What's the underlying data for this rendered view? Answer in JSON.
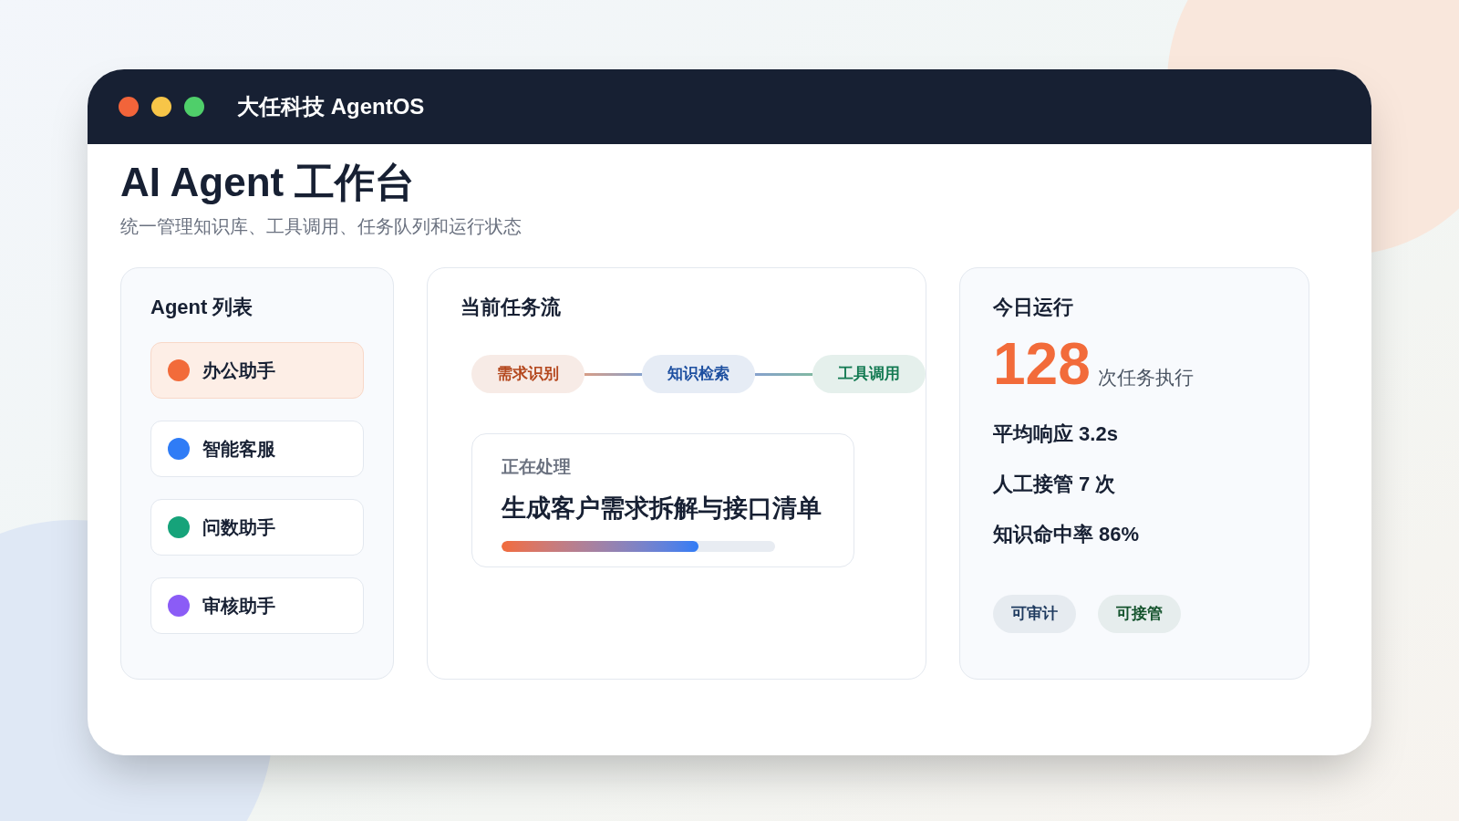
{
  "window": {
    "title": "大任科技 AgentOS"
  },
  "page": {
    "title": "AI Agent 工作台",
    "subtitle": "统一管理知识库、工具调用、任务队列和运行状态"
  },
  "agents": {
    "heading": "Agent 列表",
    "items": [
      {
        "label": "办公助手",
        "color": "#f26b3a",
        "selected": true
      },
      {
        "label": "智能客服",
        "color": "#2f7cf6",
        "selected": false
      },
      {
        "label": "问数助手",
        "color": "#16a37a",
        "selected": false
      },
      {
        "label": "审核助手",
        "color": "#8b5cf6",
        "selected": false
      }
    ]
  },
  "task_flow": {
    "heading": "当前任务流",
    "steps": [
      {
        "label": "需求识别",
        "color": "#b4471d"
      },
      {
        "label": "知识检索",
        "color": "#1d4fa0"
      },
      {
        "label": "工具调用",
        "color": "#137a52"
      }
    ],
    "processing": {
      "label": "正在处理",
      "task": "生成客户需求拆解与接口清单",
      "level": 0.72
    }
  },
  "today": {
    "heading": "今日运行",
    "count": "128",
    "count_unit": "次任务执行",
    "stats": [
      "平均响应 3.2s",
      "人工接管 7 次",
      "知识命中率 86%"
    ],
    "tags": [
      {
        "label": "可审计",
        "color": "#1e3a5f"
      },
      {
        "label": "可接管",
        "color": "#14532d"
      }
    ]
  }
}
